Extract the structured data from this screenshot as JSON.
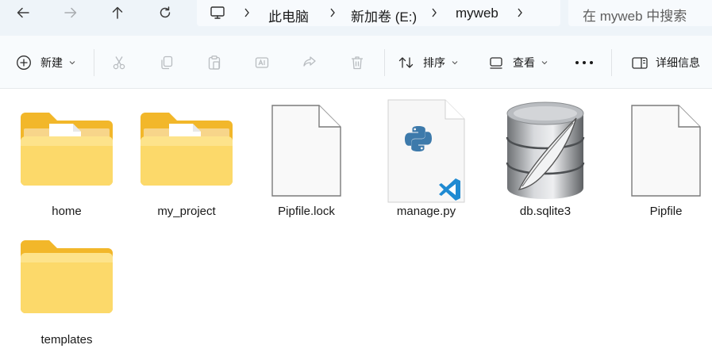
{
  "nav": {
    "back_icon": "arrow-left-icon",
    "forward_icon": "arrow-right-icon",
    "up_icon": "arrow-up-icon",
    "refresh_icon": "refresh-icon"
  },
  "breadcrumb": {
    "items": [
      {
        "label": "此电脑"
      },
      {
        "label": "新加卷 (E:)"
      },
      {
        "label": "myweb"
      }
    ]
  },
  "search": {
    "placeholder": "在 myweb 中搜索"
  },
  "toolbar": {
    "new_label": "新建",
    "sort_label": "排序",
    "view_label": "查看",
    "details_label": "详细信息"
  },
  "files": [
    {
      "name": "home",
      "type": "folder-python"
    },
    {
      "name": "my_project",
      "type": "folder-python"
    },
    {
      "name": "Pipfile.lock",
      "type": "file-blank"
    },
    {
      "name": "manage.py",
      "type": "file-python"
    },
    {
      "name": "db.sqlite3",
      "type": "file-sqlite"
    },
    {
      "name": "Pipfile",
      "type": "file-blank"
    },
    {
      "name": "templates",
      "type": "folder"
    }
  ],
  "colors": {
    "folder_back": "#f2b72a",
    "folder_front": "#fcd96a",
    "accent": "#0067c0",
    "address_bg": "#eef4f9"
  }
}
